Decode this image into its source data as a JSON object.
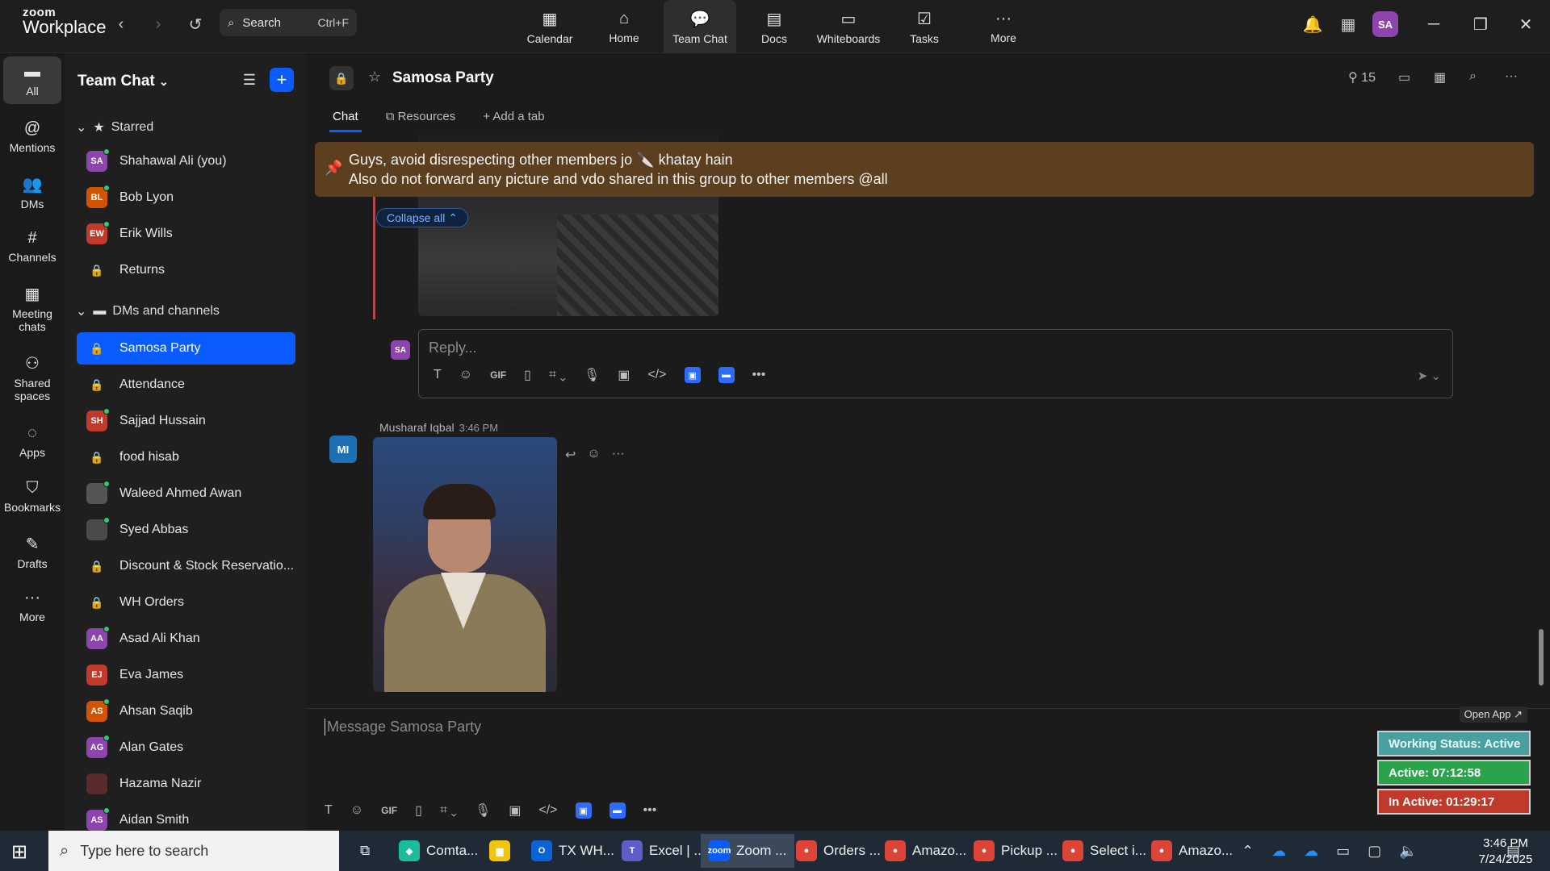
{
  "app": {
    "logo_line1": "zoom",
    "logo_line2": "Workplace",
    "search_label": "Search",
    "search_shortcut": "Ctrl+F",
    "avatar_initials": "SA"
  },
  "topnav": [
    {
      "label": "Calendar",
      "icon": "calendar-icon",
      "glyph": "▦"
    },
    {
      "label": "Home",
      "icon": "home-icon",
      "glyph": "⌂"
    },
    {
      "label": "Team Chat",
      "icon": "chat-icon",
      "glyph": "💬"
    },
    {
      "label": "Docs",
      "icon": "docs-icon",
      "glyph": "▤"
    },
    {
      "label": "Whiteboards",
      "icon": "whiteboard-icon",
      "glyph": "▭"
    },
    {
      "label": "Tasks",
      "icon": "tasks-icon",
      "glyph": "☑"
    },
    {
      "label": "More",
      "icon": "more-icon",
      "glyph": "···"
    }
  ],
  "rail": [
    {
      "label": "All",
      "glyph": "▬"
    },
    {
      "label": "Mentions",
      "glyph": "@"
    },
    {
      "label": "DMs",
      "glyph": "👥"
    },
    {
      "label": "Channels",
      "glyph": "#"
    },
    {
      "label": "Meeting chats",
      "glyph": "▦"
    },
    {
      "label": "Shared spaces",
      "glyph": "⚇"
    },
    {
      "label": "Apps",
      "glyph": "◌"
    },
    {
      "label": "Bookmarks",
      "glyph": "⛉"
    },
    {
      "label": "Drafts",
      "glyph": "✎"
    },
    {
      "label": "More",
      "glyph": "···"
    }
  ],
  "sidebar": {
    "title": "Team Chat",
    "starred_label": "Starred",
    "starred": [
      {
        "label": "Shahawal Ali (you)",
        "initials": "SA",
        "color": "#8e44ad",
        "online": true
      },
      {
        "label": "Bob Lyon",
        "initials": "BL",
        "color": "#d35400",
        "online": true
      },
      {
        "label": "Erik Wills",
        "initials": "EW",
        "color": "#c0392b",
        "online": true
      },
      {
        "label": "Returns",
        "lock": true
      }
    ],
    "dms_label": "DMs and channels",
    "dms": [
      {
        "label": "Samosa Party",
        "lock": true,
        "active": true
      },
      {
        "label": "Attendance",
        "lock": true
      },
      {
        "label": "Sajjad Hussain",
        "initials": "SH",
        "color": "#c0392b",
        "online": true
      },
      {
        "label": "food hisab",
        "lock": true
      },
      {
        "label": "Waleed Ahmed Awan",
        "initials": "",
        "color": "#555555",
        "online": true
      },
      {
        "label": "Syed Abbas",
        "initials": "",
        "color": "#4a4a4a",
        "online": true
      },
      {
        "label": "Discount & Stock Reservatio...",
        "lock": true
      },
      {
        "label": "WH Orders",
        "lock": true
      },
      {
        "label": "Asad Ali Khan",
        "initials": "AA",
        "color": "#8e44ad",
        "online": true
      },
      {
        "label": "Eva James",
        "initials": "EJ",
        "color": "#c0392b",
        "online": false
      },
      {
        "label": "Ahsan Saqib",
        "initials": "AS",
        "color": "#d35400",
        "online": true
      },
      {
        "label": "Alan Gates",
        "initials": "AG",
        "color": "#8e44ad",
        "online": true
      },
      {
        "label": "Hazama Nazir",
        "initials": "",
        "color": "#5a2a2a",
        "online": false
      },
      {
        "label": "Aidan Smith",
        "initials": "AS",
        "color": "#8e44ad",
        "online": true
      }
    ]
  },
  "channel": {
    "name": "Samosa Party",
    "member_count": "15",
    "tabs": [
      "Chat",
      "Resources",
      "Add a tab"
    ],
    "pinned_line1": "Guys, avoid disrespecting other members jo 🔪 khatay hain",
    "pinned_line2": "Also do not forward any picture and vdo shared in this group to other members @all",
    "collapse_label": "Collapse all ⌃",
    "reply_avatar": "SA",
    "reply_placeholder": "Reply...",
    "message": {
      "avatar": "MI",
      "sender": "Musharaf Iqbal",
      "time": "3:46 PM"
    },
    "composer_placeholder": "Message Samosa Party"
  },
  "status": {
    "open_app": "Open App ↗",
    "working": "Working Status: Active",
    "active": "Active: 07:12:58",
    "inactive": "In Active: 01:29:17"
  },
  "taskbar": {
    "search_placeholder": "Type here to search",
    "apps": [
      {
        "label": "Comta...",
        "color": "#1abc9c",
        "glyph": "◆"
      },
      {
        "label": "",
        "color": "#f1c40f",
        "glyph": "▆"
      },
      {
        "label": "TX WH...",
        "color": "#0a64d8",
        "glyph": "O"
      },
      {
        "label": "Excel | ...",
        "color": "#5b5fc7",
        "glyph": "T"
      },
      {
        "label": "Zoom ...",
        "color": "#0b5cff",
        "glyph": "zoom",
        "active": true
      },
      {
        "label": "Orders ...",
        "color": "#db4437",
        "glyph": "●"
      },
      {
        "label": "Amazo...",
        "color": "#db4437",
        "glyph": "●"
      },
      {
        "label": "Pickup ...",
        "color": "#db4437",
        "glyph": "●"
      },
      {
        "label": "Select i...",
        "color": "#db4437",
        "glyph": "●"
      },
      {
        "label": "Amazo...",
        "color": "#db4437",
        "glyph": "●"
      }
    ],
    "time": "3:46 PM",
    "date": "7/24/2025"
  }
}
